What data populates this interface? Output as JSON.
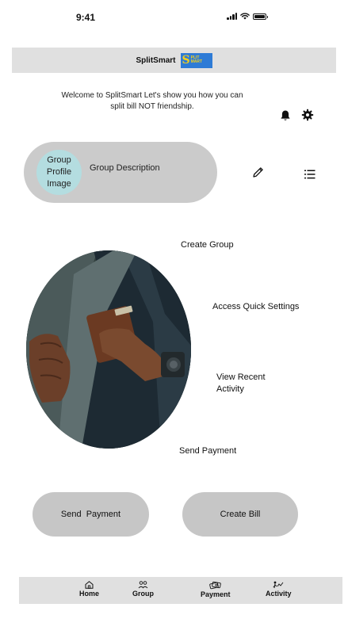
{
  "status_bar": {
    "time": "9:41"
  },
  "header": {
    "title": "SplitSmart",
    "logo_letter": "S",
    "logo_words": [
      "PLIT",
      "MART"
    ]
  },
  "welcome_text": "Welcome to SplitSmart Let's show you how you can split bill NOT friendship.",
  "group_card": {
    "avatar_text": "Group Profile Image",
    "description": "Group Description"
  },
  "hints": {
    "create_group": "Create Group",
    "quick_settings": "Access Quick Settings",
    "recent_activity": "View Recent Activity",
    "send_payment": "Send Payment"
  },
  "actions": {
    "send_payment": "Send  Payment",
    "create_bill": "Create Bill"
  },
  "tab_bar": {
    "items": [
      {
        "label": "Home",
        "icon": "home-icon"
      },
      {
        "label": "Group",
        "icon": "group-icon"
      },
      {
        "label": "Payment",
        "icon": "payment-icon"
      },
      {
        "label": "Activity",
        "icon": "activity-icon"
      }
    ]
  },
  "colors": {
    "header_bg": "#e0e0e0",
    "card_bg": "#cbcbcb",
    "avatar_bg": "#b4dde0",
    "button_bg": "#c6c6c6",
    "logo_bg": "#2e7bd6",
    "logo_fg": "#f5cf1a"
  }
}
